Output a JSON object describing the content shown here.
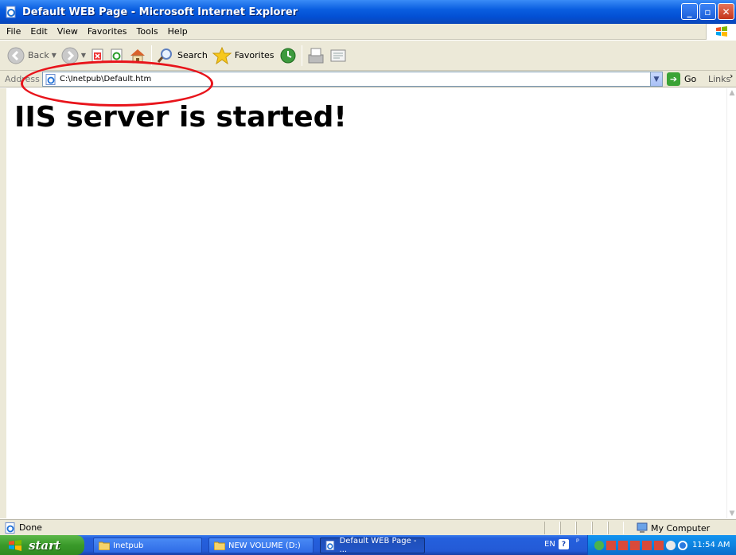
{
  "window": {
    "title": "Default WEB Page - Microsoft Internet Explorer",
    "buttons": [
      "minimize",
      "maximize",
      "close"
    ]
  },
  "menu": [
    "File",
    "Edit",
    "View",
    "Favorites",
    "Tools",
    "Help"
  ],
  "toolbar": {
    "back_label": "Back",
    "search_label": "Search",
    "favorites_label": "Favorites"
  },
  "address": {
    "label": "Address",
    "value": "C:\\Inetpub\\Default.htm",
    "go_label": "Go",
    "links_label": "Links"
  },
  "content": {
    "heading": "IIS server is started!"
  },
  "status": {
    "text": "Done",
    "zone": "My Computer"
  },
  "taskbar": {
    "start_label": "start",
    "tasks": [
      {
        "label": "Inetpub"
      },
      {
        "label": "NEW VOLUME (D:)"
      },
      {
        "label": "Default WEB Page - ..."
      }
    ],
    "lang": "EN",
    "clock": "11:54 AM"
  },
  "colors": {
    "annotation": "#e8141b",
    "titlebar": "#0a5ee0",
    "taskbar": "#2560dd",
    "start": "#3a9a2a"
  }
}
